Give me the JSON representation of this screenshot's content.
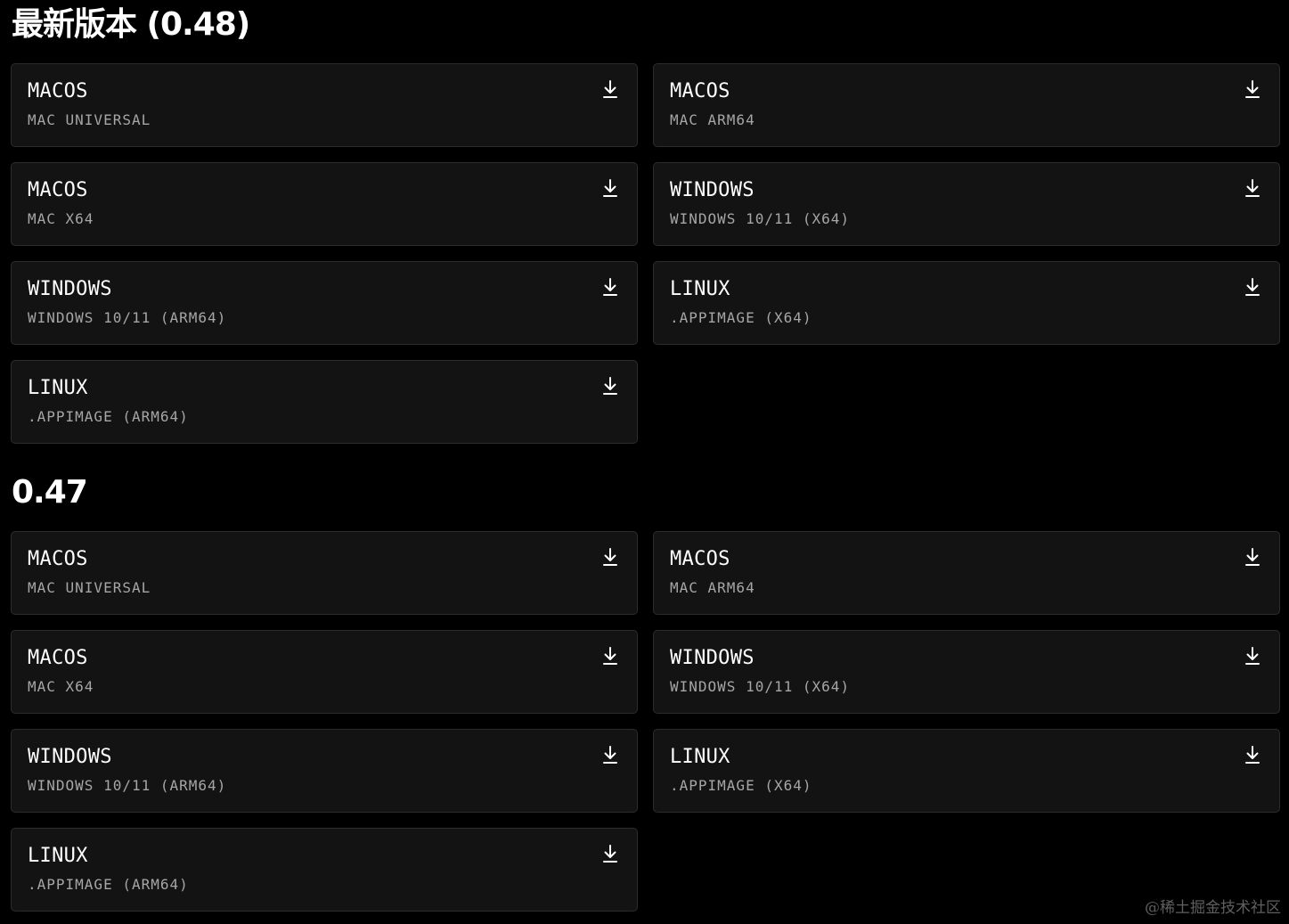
{
  "sections": [
    {
      "title": "最新版本 (0.48)",
      "downloads": [
        {
          "os": "MACOS",
          "variant": "MAC UNIVERSAL",
          "icon": "download-icon"
        },
        {
          "os": "MACOS",
          "variant": "MAC ARM64",
          "icon": "download-icon"
        },
        {
          "os": "MACOS",
          "variant": "MAC X64",
          "icon": "download-icon"
        },
        {
          "os": "WINDOWS",
          "variant": "WINDOWS 10/11 (X64)",
          "icon": "download-icon"
        },
        {
          "os": "WINDOWS",
          "variant": "WINDOWS 10/11 (ARM64)",
          "icon": "download-icon"
        },
        {
          "os": "LINUX",
          "variant": ".APPIMAGE (X64)",
          "icon": "download-icon"
        },
        {
          "os": "LINUX",
          "variant": ".APPIMAGE (ARM64)",
          "icon": "download-icon"
        }
      ]
    },
    {
      "title": "0.47",
      "downloads": [
        {
          "os": "MACOS",
          "variant": "MAC UNIVERSAL",
          "icon": "download-icon"
        },
        {
          "os": "MACOS",
          "variant": "MAC ARM64",
          "icon": "download-icon"
        },
        {
          "os": "MACOS",
          "variant": "MAC X64",
          "icon": "download-icon"
        },
        {
          "os": "WINDOWS",
          "variant": "WINDOWS 10/11 (X64)",
          "icon": "download-icon"
        },
        {
          "os": "WINDOWS",
          "variant": "WINDOWS 10/11 (ARM64)",
          "icon": "download-icon"
        },
        {
          "os": "LINUX",
          "variant": ".APPIMAGE (X64)",
          "icon": "download-icon"
        },
        {
          "os": "LINUX",
          "variant": ".APPIMAGE (ARM64)",
          "icon": "download-icon"
        }
      ]
    }
  ],
  "watermark": "@稀土掘金技术社区",
  "colors": {
    "background": "#000000",
    "card_background": "#131313",
    "card_border": "#2c2c2c",
    "primary_text": "#ffffff",
    "secondary_text": "#a6a6a6",
    "watermark_text": "#5f5f5f"
  }
}
